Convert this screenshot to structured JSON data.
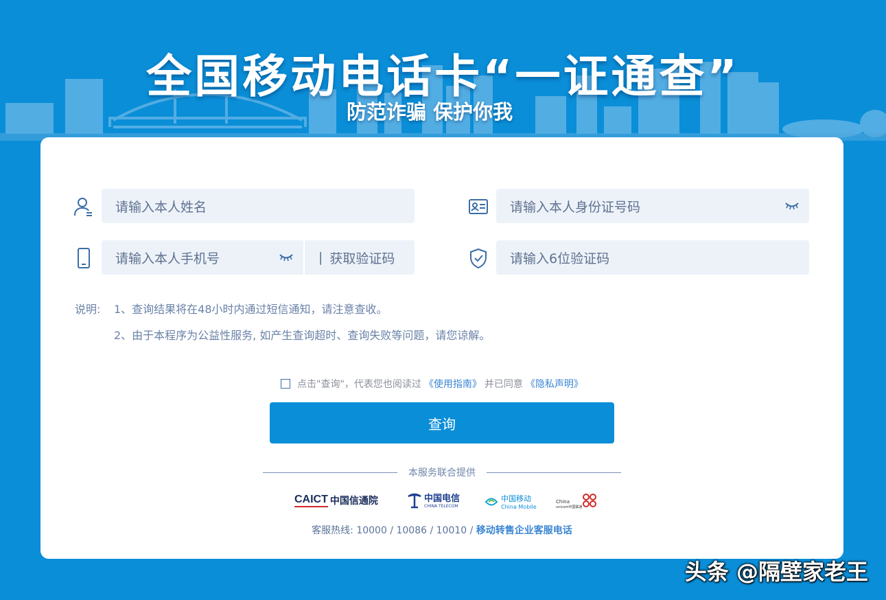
{
  "banner": {
    "title": "全国移动电话卡“一证通查”",
    "subtitle": "防范诈骗 保护你我"
  },
  "form": {
    "name_placeholder": "请输入本人姓名",
    "id_placeholder": "请输入本人身份证号码",
    "phone_placeholder": "请输入本人手机号",
    "get_code_label": "获取验证码",
    "code_placeholder": "请输入6位验证码"
  },
  "notes": {
    "label": "说明:",
    "items": [
      "1、查询结果将在48小时内通过短信通知，请注意查收。",
      "2、由于本程序为公益性服务, 如产生查询超时、查询失败等问题，请您谅解。"
    ]
  },
  "agreement": {
    "prefix": "点击\"查询\"，代表您也阅读过",
    "guide_link": "《使用指南》",
    "middle": "并已同意",
    "privacy_link": "《隐私声明》",
    "checked": false
  },
  "query_button": "查询",
  "providers": {
    "heading": "本服务联合提供",
    "caict_mark": "CAICT",
    "caict_name": "中国信通院",
    "telecom_cn": "中国电信",
    "telecom_en": "CHINA TELECOM",
    "mobile_cn": "中国移动",
    "mobile_en": "China Mobile",
    "unicom_en": "China",
    "unicom_sub": "unicom中国联通"
  },
  "hotline": {
    "prefix": "客服热线: 10000 / 10086 / 10010 /",
    "link": "移动转售企业客服电话"
  },
  "watermark": "头条 @隔壁家老王",
  "colors": {
    "background": "#0a8ed8",
    "button": "#0a8ed8",
    "field_bg": "#edf2f9",
    "link": "#3a86d3"
  }
}
